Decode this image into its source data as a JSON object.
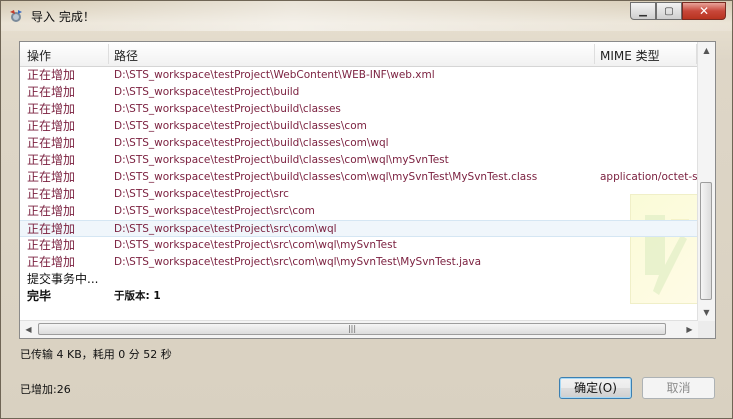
{
  "window": {
    "title": "导入 完成！",
    "minimize_label": "▁",
    "maximize_label": "▢",
    "close_label": "✕"
  },
  "table": {
    "columns": [
      "操作",
      "路径",
      "MIME 类型"
    ],
    "rows": [
      {
        "action": "正在增加",
        "path": "D:\\STS_workspace\\testProject\\WebContent\\WEB-INF\\web.xml",
        "mime": ""
      },
      {
        "action": "正在增加",
        "path": "D:\\STS_workspace\\testProject\\build",
        "mime": ""
      },
      {
        "action": "正在增加",
        "path": "D:\\STS_workspace\\testProject\\build\\classes",
        "mime": ""
      },
      {
        "action": "正在增加",
        "path": "D:\\STS_workspace\\testProject\\build\\classes\\com",
        "mime": ""
      },
      {
        "action": "正在增加",
        "path": "D:\\STS_workspace\\testProject\\build\\classes\\com\\wql",
        "mime": ""
      },
      {
        "action": "正在增加",
        "path": "D:\\STS_workspace\\testProject\\build\\classes\\com\\wql\\mySvnTest",
        "mime": ""
      },
      {
        "action": "正在增加",
        "path": "D:\\STS_workspace\\testProject\\build\\classes\\com\\wql\\mySvnTest\\MySvnTest.class",
        "mime": "application/octet-str"
      },
      {
        "action": "正在增加",
        "path": "D:\\STS_workspace\\testProject\\src",
        "mime": ""
      },
      {
        "action": "正在增加",
        "path": "D:\\STS_workspace\\testProject\\src\\com",
        "mime": ""
      },
      {
        "action": "正在增加",
        "path": "D:\\STS_workspace\\testProject\\src\\com\\wql",
        "mime": ""
      },
      {
        "action": "正在增加",
        "path": "D:\\STS_workspace\\testProject\\src\\com\\wql\\mySvnTest",
        "mime": ""
      },
      {
        "action": "正在增加",
        "path": "D:\\STS_workspace\\testProject\\src\\com\\wql\\mySvnTest\\MySvnTest.java",
        "mime": ""
      },
      {
        "action": "提交事务中...",
        "path": "",
        "mime": ""
      },
      {
        "action": "完毕",
        "path": "于版本: 1",
        "mime": ""
      }
    ]
  },
  "status": {
    "transfer": "已传输 4 KB，耗用 0 分 52 秒",
    "added": "已增加:26"
  },
  "buttons": {
    "ok": "确定(O)",
    "cancel": "取消"
  },
  "colors": {
    "action_purple": "#7a1f3e",
    "selected_row": "#f0f6fb"
  }
}
